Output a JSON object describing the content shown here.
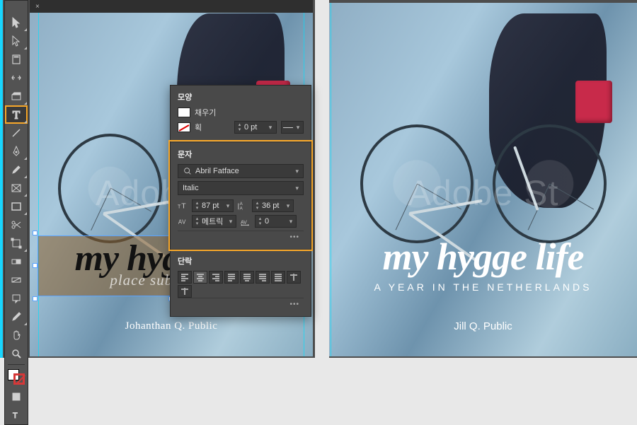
{
  "tabbar": {
    "close": "×"
  },
  "tools": {
    "selection": "selection-tool",
    "direct": "direct-selection-tool",
    "page": "page-tool",
    "gap": "gap-tool",
    "contentcollector": "content-collector-tool",
    "type": "type-tool",
    "line": "line-tool",
    "pen": "pen-tool",
    "pencil": "pencil-tool",
    "rectframe": "rectangle-frame-tool",
    "rect": "rectangle-tool",
    "scissors": "scissors-tool",
    "freetransform": "free-transform-tool",
    "gradientswatch": "gradient-swatch-tool",
    "gradientfeather": "gradient-feather-tool",
    "note": "note-tool",
    "eyedropper": "eyedropper-tool",
    "hand": "hand-tool",
    "zoom": "zoom-tool"
  },
  "panel": {
    "shape_heading": "모양",
    "fill_label": "채우기",
    "stroke_label": "획",
    "stroke_weight": "0 pt",
    "char_heading": "문자",
    "font_family": "Abril Fatface",
    "font_style": "Italic",
    "font_size": "87 pt",
    "leading": "36 pt",
    "kerning": "메트릭",
    "tracking": "0",
    "para_heading": "단락"
  },
  "left_doc": {
    "watermark": "Adobe St",
    "title": "my hygge life",
    "subtitle": "place subtitle here",
    "author": "Johanthan Q. Public"
  },
  "right_doc": {
    "watermark": "Adobe St",
    "title": "my hygge life",
    "subtitle": "A YEAR IN THE NETHERLANDS",
    "author": "Jill Q. Public"
  }
}
